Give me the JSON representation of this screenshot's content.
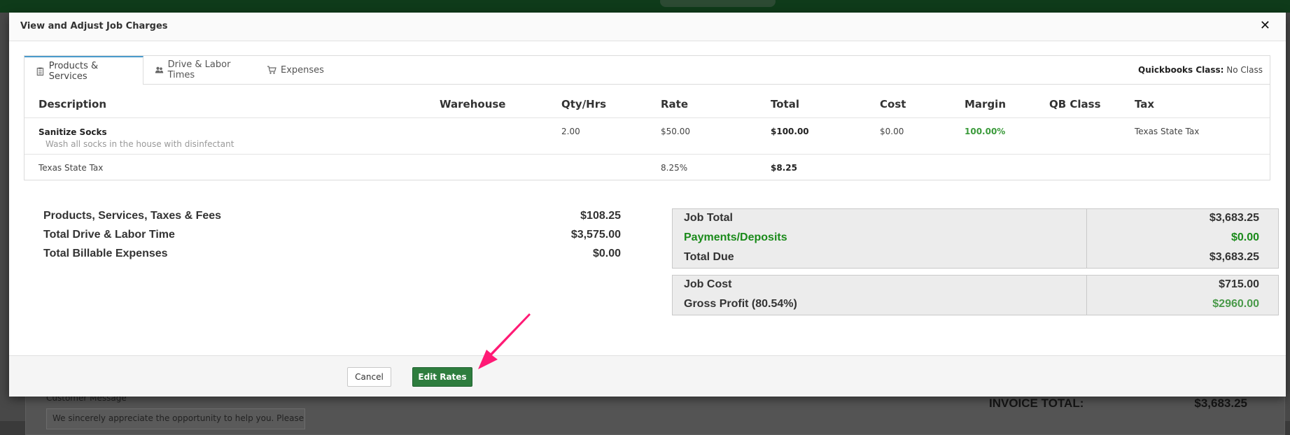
{
  "background": {
    "customer_message_label": "Customer Message",
    "customer_message_text": "We sincerely appreciate the opportunity to help you. Please remit",
    "invoice_total_label": "INVOICE TOTAL:",
    "invoice_total_value": "$3,683.25"
  },
  "modal": {
    "title": "View and Adjust Job Charges",
    "close_icon": "close-icon",
    "tabs": [
      {
        "label": "Products & Services",
        "icon": "clipboard-icon",
        "active": true
      },
      {
        "label": "Drive & Labor Times",
        "icon": "users-icon",
        "active": false
      },
      {
        "label": "Expenses",
        "icon": "cart-icon",
        "active": false
      }
    ],
    "qb_class_label": "Quickbooks Class:",
    "qb_class_value": "No Class",
    "table": {
      "headers": [
        "Description",
        "Warehouse",
        "Qty/Hrs",
        "Rate",
        "Total",
        "Cost",
        "Margin",
        "QB Class",
        "Tax"
      ],
      "item": {
        "name": "Sanitize Socks",
        "description": "Wash all socks in the house with disinfectant",
        "qty": "2.00",
        "rate": "$50.00",
        "total": "$100.00",
        "cost": "$0.00",
        "margin": "100.00%",
        "tax": "Texas State Tax"
      },
      "tax_row": {
        "name": "Texas State Tax",
        "rate": "8.25%",
        "total": "$8.25"
      }
    },
    "summary": [
      {
        "label": "Products, Services, Taxes & Fees",
        "value": "$108.25"
      },
      {
        "label": "Total Drive & Labor Time",
        "value": "$3,575.00"
      },
      {
        "label": "Total Billable Expenses",
        "value": "$0.00"
      }
    ],
    "totals": {
      "job_total_label": "Job Total",
      "job_total_value": "$3,683.25",
      "payments_label": "Payments/Deposits",
      "payments_value": "$0.00",
      "total_due_label": "Total Due",
      "total_due_value": "$3,683.25",
      "job_cost_label": "Job Cost",
      "job_cost_value": "$715.00",
      "gross_profit_label": "Gross Profit (80.54%)",
      "gross_profit_value": "$2960.00"
    },
    "buttons": {
      "cancel": "Cancel",
      "edit_rates": "Edit Rates"
    }
  },
  "colors": {
    "primary_button": "#2e7d3e",
    "positive_green": "#1a8a1a",
    "annotation_arrow": "#ff1a75",
    "active_tab_accent": "#4a9acb"
  }
}
